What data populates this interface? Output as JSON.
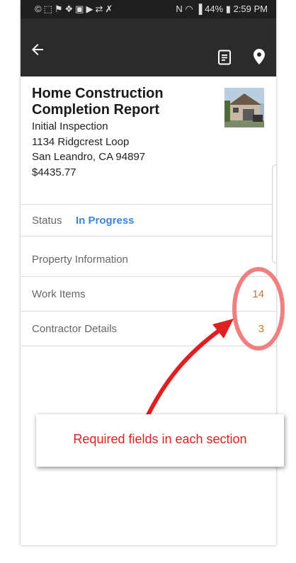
{
  "status_bar": {
    "time": "2:59 PM",
    "battery": "44%",
    "left_icons": [
      "whatsapp-icon",
      "screenshot-icon",
      "usb-icon",
      "dropbox-icon",
      "gallery-icon",
      "video-icon",
      "transfer-icon",
      "no-sim-icon"
    ],
    "right_icons": [
      "nfc-icon",
      "wifi-icon",
      "signal-icon",
      "battery-icon"
    ]
  },
  "app_bar": {
    "icons": [
      "back-arrow-icon",
      "document-icon",
      "location-pin-icon"
    ],
    "background": "#2b2b2b"
  },
  "report": {
    "title": "Home Construction Completion Report",
    "inspection_type": "Initial Inspection",
    "address_line1": "1134 Ridgcrest Loop",
    "address_line2": "San Leandro, CA 94897",
    "amount": "$4435.77"
  },
  "status": {
    "label": "Status",
    "value": "In Progress",
    "color": "#3b86d8"
  },
  "sections": [
    {
      "label": "Property Information",
      "count": ""
    },
    {
      "label": "Work Items",
      "count": "14"
    },
    {
      "label": "Contractor Details",
      "count": "3"
    }
  ],
  "annotation": {
    "callout_text": "Required fields in each section",
    "color": "#e02020",
    "highlight_color": "#f08080"
  },
  "colors": {
    "count": "#c8782a"
  }
}
